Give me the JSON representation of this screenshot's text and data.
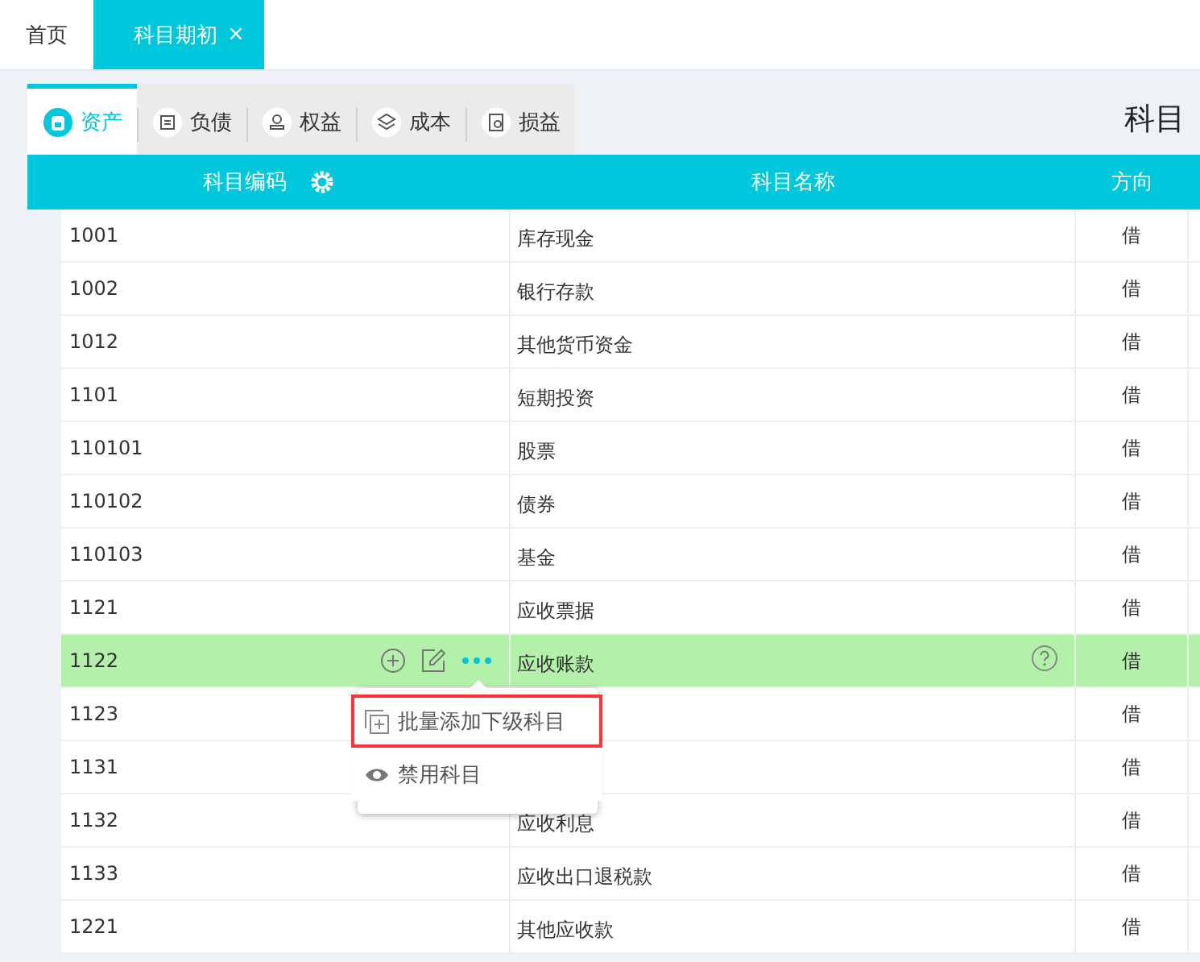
{
  "top_tabs": [
    {
      "label": "首页",
      "selected": false
    },
    {
      "label": "科目期初",
      "selected": true,
      "close": "×"
    }
  ],
  "category_tabs": [
    {
      "label": "资产",
      "selected": true
    },
    {
      "label": "负债",
      "selected": false
    },
    {
      "label": "权益",
      "selected": false
    },
    {
      "label": "成本",
      "selected": false
    },
    {
      "label": "损益",
      "selected": false
    }
  ],
  "page_title": "科目",
  "table": {
    "columns": [
      "科目编码",
      "科目名称",
      "方向"
    ],
    "rows": [
      {
        "code": "1001",
        "name": "库存现金",
        "direction": "借",
        "selected": false
      },
      {
        "code": "1002",
        "name": "银行存款",
        "direction": "借",
        "selected": false
      },
      {
        "code": "1012",
        "name": "其他货币资金",
        "direction": "借",
        "selected": false
      },
      {
        "code": "1101",
        "name": "短期投资",
        "direction": "借",
        "selected": false
      },
      {
        "code": "110101",
        "name": "股票",
        "direction": "借",
        "selected": false
      },
      {
        "code": "110102",
        "name": "债券",
        "direction": "借",
        "selected": false
      },
      {
        "code": "110103",
        "name": "基金",
        "direction": "借",
        "selected": false
      },
      {
        "code": "1121",
        "name": "应收票据",
        "direction": "借",
        "selected": false
      },
      {
        "code": "1122",
        "name": "应收账款",
        "direction": "借",
        "selected": true
      },
      {
        "code": "1123",
        "direction": "借",
        "selected": false
      },
      {
        "code": "1131",
        "direction": "借",
        "selected": false
      },
      {
        "code": "1132",
        "name": "应收利息",
        "direction": "借",
        "selected": false
      },
      {
        "code": "1133",
        "name": "应收出口退税款",
        "direction": "借",
        "selected": false
      },
      {
        "code": "1221",
        "name": "其他应收款",
        "direction": "借",
        "selected": false
      }
    ]
  },
  "row_menu": [
    {
      "label": "批量添加下级科目",
      "kind": "batch-add",
      "highlighted": true
    },
    {
      "label": "禁用科目",
      "kind": "disable",
      "highlighted": false
    }
  ]
}
